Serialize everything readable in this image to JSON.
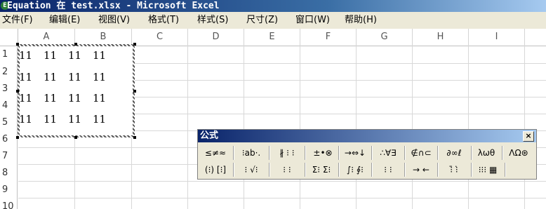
{
  "window": {
    "title": "Equation 在 test.xlsx - Microsoft Excel",
    "icon": "excel-icon"
  },
  "menu": [
    {
      "label": "文件(F)"
    },
    {
      "label": "编辑(E)"
    },
    {
      "label": "视图(V)"
    },
    {
      "label": "格式(T)"
    },
    {
      "label": "样式(S)"
    },
    {
      "label": "尺寸(Z)"
    },
    {
      "label": "窗口(W)"
    },
    {
      "label": "帮助(H)"
    }
  ],
  "sheet": {
    "columns": [
      "A",
      "B",
      "C",
      "D",
      "E",
      "F",
      "G",
      "H",
      "I"
    ],
    "rows": [
      "1",
      "2",
      "3",
      "4",
      "5",
      "6",
      "7",
      "8",
      "9",
      "10"
    ],
    "matrix": [
      [
        "11",
        "11",
        "11",
        "11"
      ],
      [
        "11",
        "11",
        "11",
        "11"
      ],
      [
        "11",
        "11",
        "11",
        "11"
      ],
      [
        "11",
        "11",
        "11",
        "11"
      ]
    ]
  },
  "equation_toolbar": {
    "title": "公式",
    "close_label": "×",
    "row1": [
      "≤≠≈",
      "⁝ab·.",
      "∦ ⁝ ⁝",
      "±•⊗",
      "→⇔↓",
      "∴∀∃",
      "∉∩⊂",
      "∂∞ℓ",
      "λωθ",
      "ΛΩ⊛"
    ],
    "row2": [
      "(⁝) [⁝]",
      "⁝ √⁝",
      "⁝ ⁝",
      "Σ⁝ Σ⁝",
      "∫⁝ ∮⁝",
      "⁝ ⁝",
      "→ ←",
      "⁝̄ ⁝̇",
      "⁝⁝⁝ ▦"
    ]
  }
}
